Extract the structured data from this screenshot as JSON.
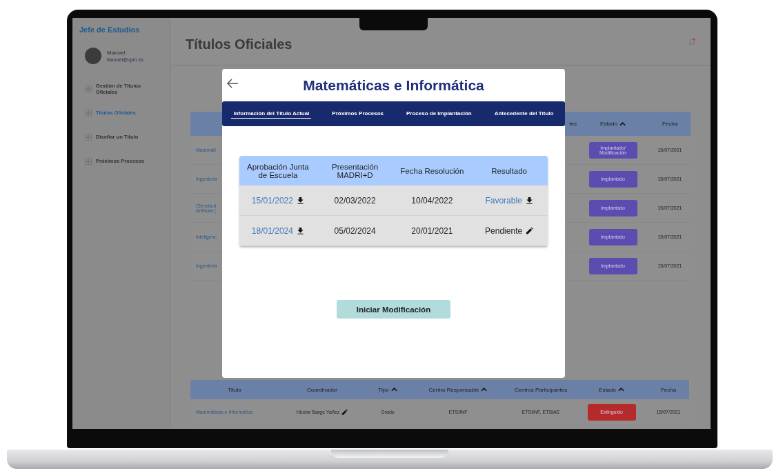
{
  "sidebar": {
    "app_title": "Jefe de Estudios",
    "user": {
      "name": "Manuel",
      "email": "Manuel@upm.es"
    },
    "items": [
      {
        "label": "Gestión de Títulos Oficiales",
        "selected": false
      },
      {
        "label": "Titulos Oficiales",
        "selected": true
      },
      {
        "label": "Diseñar un Título",
        "selected": false
      },
      {
        "label": "Próximos Procesos",
        "selected": false
      }
    ]
  },
  "page_title": "Títulos Oficiales",
  "background_table": {
    "columns": [
      {
        "label": "tes",
        "sorted": false
      },
      {
        "label": "Estado",
        "sorted": true
      },
      {
        "label": "Fecha",
        "sorted": false
      }
    ],
    "rows": [
      {
        "title_lines": [
          "Matemáti"
        ],
        "estado_lines": [
          "Implantado/",
          "Modificación"
        ],
        "color": "#5b4db0",
        "fecha": "15/07/2021"
      },
      {
        "title_lines": [
          "Ingenieria"
        ],
        "estado_lines": [
          "Implantado"
        ],
        "color": "#5b4db0",
        "fecha": "15/07/2021"
      },
      {
        "title_lines": [
          "Ciencia d",
          "Artificial ("
        ],
        "estado_lines": [
          "Implantado"
        ],
        "color": "#5b4db0",
        "fecha": "15/07/2021"
      },
      {
        "title_lines": [
          "Inteligenc"
        ],
        "estado_lines": [
          "Implantado"
        ],
        "color": "#5b4db0",
        "fecha": "15/07/2021"
      },
      {
        "title_lines": [
          "Ingenieria"
        ],
        "estado_lines": [
          "Implantado"
        ],
        "color": "#5b4db0",
        "fecha": "15/07/2021"
      }
    ]
  },
  "bottom_table": {
    "columns": [
      {
        "label": "Titulo",
        "sorted": false
      },
      {
        "label": "Coordinador",
        "sorted": false
      },
      {
        "label": "Tipo",
        "sorted": true
      },
      {
        "label": "Centro Responsable",
        "sorted": true
      },
      {
        "label": "Centros Participantes",
        "sorted": false
      },
      {
        "label": "Estado",
        "sorted": true
      },
      {
        "label": "Fecha",
        "sorted": false
      }
    ],
    "rows": [
      {
        "titulo": "Matemáticas e Informática",
        "coordinador": "Héctor Barge Yañez",
        "editable": true,
        "tipo": "Grado",
        "centro": "ETSIINF",
        "centros": "ETSIINF, ETSIAE",
        "estado": "Extinguido",
        "color": "#b52a2a",
        "fecha": "15/07/2021"
      }
    ]
  },
  "modal": {
    "title": "Matemáticas e Informática",
    "tabs": [
      {
        "label": "Información del Título Actual",
        "selected": true
      },
      {
        "label": "Próximos Procesos",
        "selected": false
      },
      {
        "label": "Proceso de Implantación",
        "selected": false
      },
      {
        "label": "Antecedente del Título",
        "selected": false
      }
    ],
    "table": {
      "columns": [
        "Aprobación Junta de Escuela",
        "Presentación MADRI+D",
        "Fecha Resolución",
        "Resultado"
      ],
      "rows": [
        {
          "cells": [
            {
              "text": "15/01/2022",
              "kind": "download"
            },
            {
              "text": "02/03/2022",
              "kind": "text"
            },
            {
              "text": "10/04/2022",
              "kind": "text"
            },
            {
              "text": "Favorable",
              "kind": "download"
            }
          ]
        },
        {
          "cells": [
            {
              "text": "18/01/2024",
              "kind": "download"
            },
            {
              "text": "05/02/2024",
              "kind": "text"
            },
            {
              "text": "20/01/2021",
              "kind": "text"
            },
            {
              "text": "Pendiente",
              "kind": "edit"
            }
          ]
        }
      ]
    },
    "button": "Iniciar Modificación"
  }
}
